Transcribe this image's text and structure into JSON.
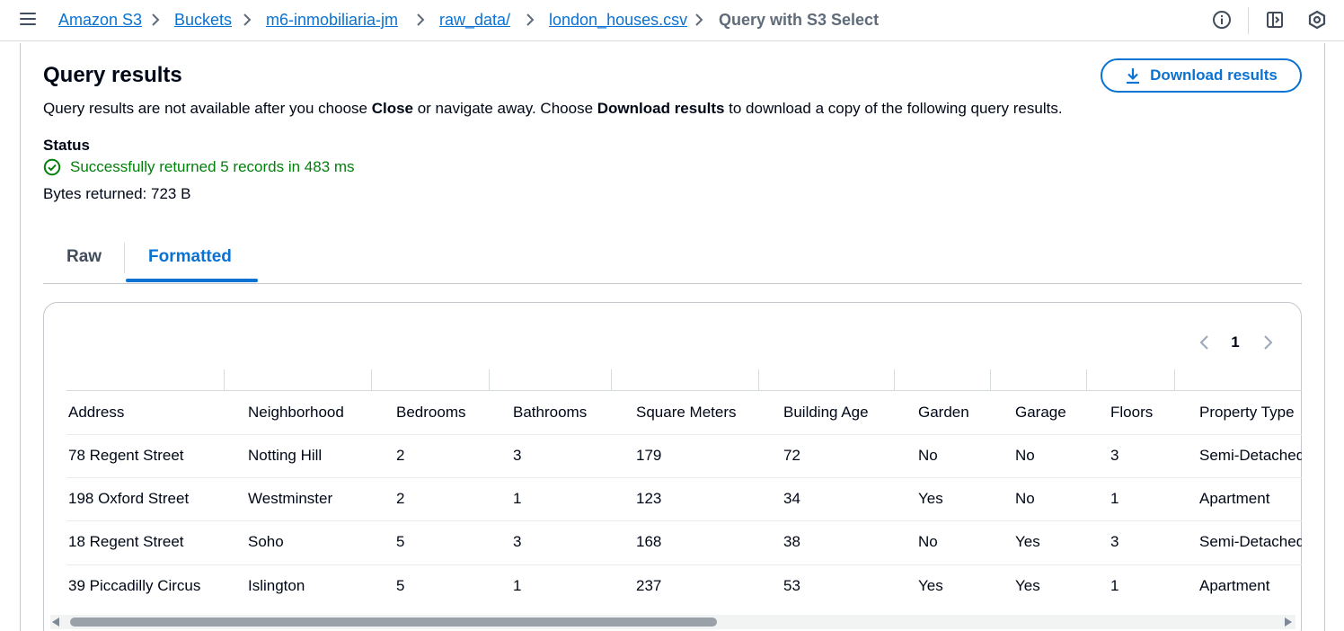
{
  "topbar": {
    "menu_icon": "hamburger-menu-icon",
    "breadcrumbs": [
      {
        "label": "Amazon S3",
        "link": true
      },
      {
        "label": "Buckets",
        "link": true
      },
      {
        "label": "m6-inmobiliaria-jm",
        "link": true
      },
      {
        "label": "raw_data/",
        "link": true
      },
      {
        "label": "london_houses.csv",
        "link": true
      },
      {
        "label": "Query with S3 Select",
        "link": false
      }
    ],
    "right_icons": [
      "info-icon",
      "notifications-panel-icon",
      "settings-hex-icon"
    ]
  },
  "results": {
    "title": "Query results",
    "download_label": "Download results",
    "desc_pre": "Query results are not available after you choose ",
    "desc_close": "Close",
    "desc_mid": " or navigate away. Choose ",
    "desc_download": "Download results",
    "desc_post": " to download a copy of the following query results.",
    "status_label": "Status",
    "status_text": "Successfully returned 5 records in 483 ms",
    "bytes_text": "Bytes returned: 723 B"
  },
  "tabs": [
    {
      "label": "Raw",
      "selected": false
    },
    {
      "label": "Formatted",
      "selected": true
    }
  ],
  "pagination": {
    "current_page": "1"
  },
  "table": {
    "columns": [
      "Address",
      "Neighborhood",
      "Bedrooms",
      "Bathrooms",
      "Square Meters",
      "Building Age",
      "Garden",
      "Garage",
      "Floors",
      "Property Type"
    ],
    "rows": [
      [
        "78 Regent Street",
        "Notting Hill",
        "2",
        "3",
        "179",
        "72",
        "No",
        "No",
        "3",
        "Semi-Detached"
      ],
      [
        "198 Oxford Street",
        "Westminster",
        "2",
        "1",
        "123",
        "34",
        "Yes",
        "No",
        "1",
        "Apartment"
      ],
      [
        "18 Regent Street",
        "Soho",
        "5",
        "3",
        "168",
        "38",
        "No",
        "Yes",
        "3",
        "Semi-Detached"
      ],
      [
        "39 Piccadilly Circus",
        "Islington",
        "5",
        "1",
        "237",
        "53",
        "Yes",
        "Yes",
        "1",
        "Apartment"
      ]
    ]
  },
  "colors": {
    "link": "#0972d3",
    "success": "#037f0c",
    "text": "#000716"
  }
}
